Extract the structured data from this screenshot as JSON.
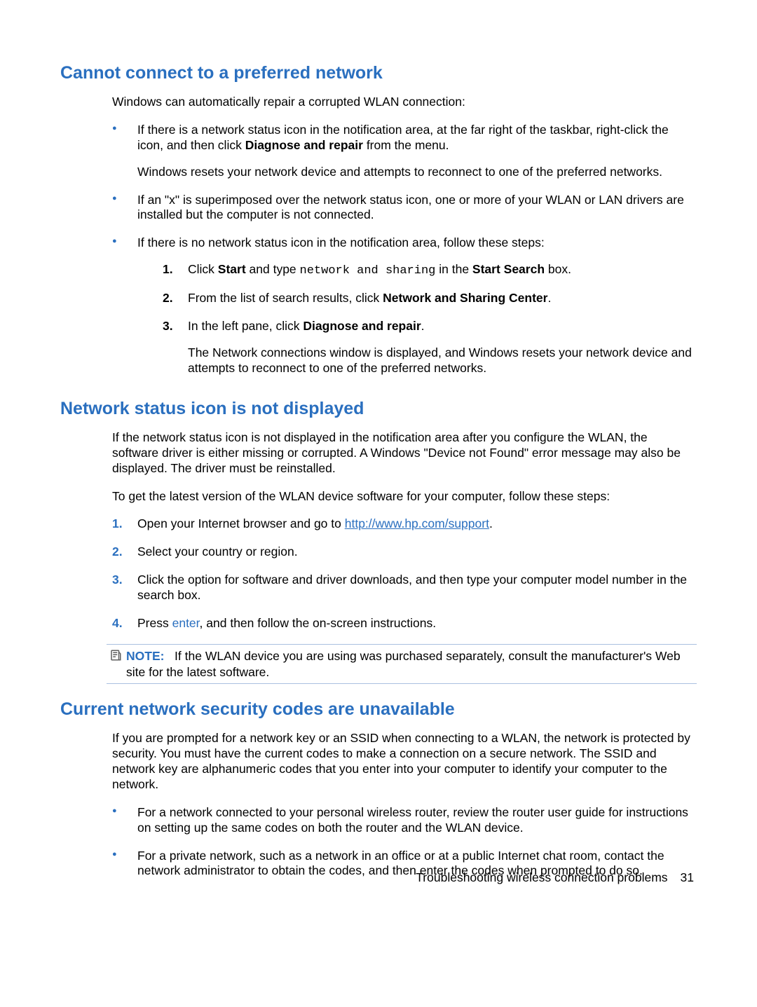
{
  "section1": {
    "heading": "Cannot connect to a preferred network",
    "intro": "Windows can automatically repair a corrupted WLAN connection:",
    "b1_a": "If there is a network status icon in the notification area, at the far right of the taskbar, right-click the icon, and then click ",
    "b1_bold": "Diagnose and repair",
    "b1_b": " from the menu.",
    "b1_p2": "Windows resets your network device and attempts to reconnect to one of the preferred networks.",
    "b2": "If an \"x\" is superimposed over the network status icon, one or more of your WLAN or LAN drivers are installed but the computer is not connected.",
    "b3_intro": "If there is no network status icon in the notification area, follow these steps:",
    "s1_num": "1.",
    "s1_a": "Click ",
    "s1_bold1": "Start",
    "s1_b": " and type ",
    "s1_mono": "network and sharing",
    "s1_c": " in the ",
    "s1_bold2": "Start Search",
    "s1_d": " box.",
    "s2_num": "2.",
    "s2_a": "From the list of search results, click ",
    "s2_bold": "Network and Sharing Center",
    "s2_b": ".",
    "s3_num": "3.",
    "s3_a": "In the left pane, click ",
    "s3_bold": "Diagnose and repair",
    "s3_b": ".",
    "s3_p2": "The Network connections window is displayed, and Windows resets your network device and attempts to reconnect to one of the preferred networks."
  },
  "section2": {
    "heading": "Network status icon is not displayed",
    "p1": "If the network status icon is not displayed in the notification area after you configure the WLAN, the software driver is either missing or corrupted. A Windows \"Device not Found\" error message may also be displayed. The driver must be reinstalled.",
    "p2": "To get the latest version of the WLAN device software for your computer, follow these steps:",
    "s1_num": "1.",
    "s1_a": "Open your Internet browser and go to ",
    "s1_link": "http://www.hp.com/support",
    "s1_b": ".",
    "s2_num": "2.",
    "s2": "Select your country or region.",
    "s3_num": "3.",
    "s3": "Click the option for software and driver downloads, and then type your computer model number in the search box.",
    "s4_num": "4.",
    "s4_a": "Press ",
    "s4_kw": "enter",
    "s4_b": ", and then follow the on-screen instructions.",
    "note_label": "NOTE:",
    "note_text": "If the WLAN device you are using was purchased separately, consult the manufacturer's Web site for the latest software."
  },
  "section3": {
    "heading": "Current network security codes are unavailable",
    "p1": "If you are prompted for a network key or an SSID when connecting to a WLAN, the network is protected by security. You must have the current codes to make a connection on a secure network. The SSID and network key are alphanumeric codes that you enter into your computer to identify your computer to the network.",
    "b1": "For a network connected to your personal wireless router, review the router user guide for instructions on setting up the same codes on both the router and the WLAN device.",
    "b2": "For a private network, such as a network in an office or at a public Internet chat room, contact the network administrator to obtain the codes, and then enter the codes when prompted to do so."
  },
  "footer": {
    "text": "Troubleshooting wireless connection problems",
    "page": "31"
  }
}
